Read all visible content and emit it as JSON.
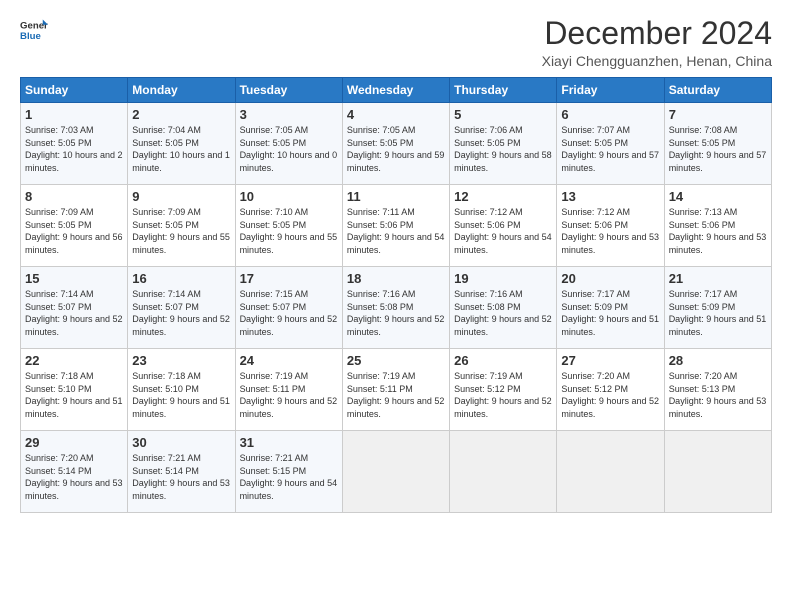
{
  "logo": {
    "line1": "General",
    "line2": "Blue"
  },
  "title": "December 2024",
  "location": "Xiayi Chengguanzhen, Henan, China",
  "days_header": [
    "Sunday",
    "Monday",
    "Tuesday",
    "Wednesday",
    "Thursday",
    "Friday",
    "Saturday"
  ],
  "weeks": [
    [
      {
        "day": "1",
        "sunrise": "Sunrise: 7:03 AM",
        "sunset": "Sunset: 5:05 PM",
        "daylight": "Daylight: 10 hours and 2 minutes."
      },
      {
        "day": "2",
        "sunrise": "Sunrise: 7:04 AM",
        "sunset": "Sunset: 5:05 PM",
        "daylight": "Daylight: 10 hours and 1 minute."
      },
      {
        "day": "3",
        "sunrise": "Sunrise: 7:05 AM",
        "sunset": "Sunset: 5:05 PM",
        "daylight": "Daylight: 10 hours and 0 minutes."
      },
      {
        "day": "4",
        "sunrise": "Sunrise: 7:05 AM",
        "sunset": "Sunset: 5:05 PM",
        "daylight": "Daylight: 9 hours and 59 minutes."
      },
      {
        "day": "5",
        "sunrise": "Sunrise: 7:06 AM",
        "sunset": "Sunset: 5:05 PM",
        "daylight": "Daylight: 9 hours and 58 minutes."
      },
      {
        "day": "6",
        "sunrise": "Sunrise: 7:07 AM",
        "sunset": "Sunset: 5:05 PM",
        "daylight": "Daylight: 9 hours and 57 minutes."
      },
      {
        "day": "7",
        "sunrise": "Sunrise: 7:08 AM",
        "sunset": "Sunset: 5:05 PM",
        "daylight": "Daylight: 9 hours and 57 minutes."
      }
    ],
    [
      {
        "day": "8",
        "sunrise": "Sunrise: 7:09 AM",
        "sunset": "Sunset: 5:05 PM",
        "daylight": "Daylight: 9 hours and 56 minutes."
      },
      {
        "day": "9",
        "sunrise": "Sunrise: 7:09 AM",
        "sunset": "Sunset: 5:05 PM",
        "daylight": "Daylight: 9 hours and 55 minutes."
      },
      {
        "day": "10",
        "sunrise": "Sunrise: 7:10 AM",
        "sunset": "Sunset: 5:05 PM",
        "daylight": "Daylight: 9 hours and 55 minutes."
      },
      {
        "day": "11",
        "sunrise": "Sunrise: 7:11 AM",
        "sunset": "Sunset: 5:06 PM",
        "daylight": "Daylight: 9 hours and 54 minutes."
      },
      {
        "day": "12",
        "sunrise": "Sunrise: 7:12 AM",
        "sunset": "Sunset: 5:06 PM",
        "daylight": "Daylight: 9 hours and 54 minutes."
      },
      {
        "day": "13",
        "sunrise": "Sunrise: 7:12 AM",
        "sunset": "Sunset: 5:06 PM",
        "daylight": "Daylight: 9 hours and 53 minutes."
      },
      {
        "day": "14",
        "sunrise": "Sunrise: 7:13 AM",
        "sunset": "Sunset: 5:06 PM",
        "daylight": "Daylight: 9 hours and 53 minutes."
      }
    ],
    [
      {
        "day": "15",
        "sunrise": "Sunrise: 7:14 AM",
        "sunset": "Sunset: 5:07 PM",
        "daylight": "Daylight: 9 hours and 52 minutes."
      },
      {
        "day": "16",
        "sunrise": "Sunrise: 7:14 AM",
        "sunset": "Sunset: 5:07 PM",
        "daylight": "Daylight: 9 hours and 52 minutes."
      },
      {
        "day": "17",
        "sunrise": "Sunrise: 7:15 AM",
        "sunset": "Sunset: 5:07 PM",
        "daylight": "Daylight: 9 hours and 52 minutes."
      },
      {
        "day": "18",
        "sunrise": "Sunrise: 7:16 AM",
        "sunset": "Sunset: 5:08 PM",
        "daylight": "Daylight: 9 hours and 52 minutes."
      },
      {
        "day": "19",
        "sunrise": "Sunrise: 7:16 AM",
        "sunset": "Sunset: 5:08 PM",
        "daylight": "Daylight: 9 hours and 52 minutes."
      },
      {
        "day": "20",
        "sunrise": "Sunrise: 7:17 AM",
        "sunset": "Sunset: 5:09 PM",
        "daylight": "Daylight: 9 hours and 51 minutes."
      },
      {
        "day": "21",
        "sunrise": "Sunrise: 7:17 AM",
        "sunset": "Sunset: 5:09 PM",
        "daylight": "Daylight: 9 hours and 51 minutes."
      }
    ],
    [
      {
        "day": "22",
        "sunrise": "Sunrise: 7:18 AM",
        "sunset": "Sunset: 5:10 PM",
        "daylight": "Daylight: 9 hours and 51 minutes."
      },
      {
        "day": "23",
        "sunrise": "Sunrise: 7:18 AM",
        "sunset": "Sunset: 5:10 PM",
        "daylight": "Daylight: 9 hours and 51 minutes."
      },
      {
        "day": "24",
        "sunrise": "Sunrise: 7:19 AM",
        "sunset": "Sunset: 5:11 PM",
        "daylight": "Daylight: 9 hours and 52 minutes."
      },
      {
        "day": "25",
        "sunrise": "Sunrise: 7:19 AM",
        "sunset": "Sunset: 5:11 PM",
        "daylight": "Daylight: 9 hours and 52 minutes."
      },
      {
        "day": "26",
        "sunrise": "Sunrise: 7:19 AM",
        "sunset": "Sunset: 5:12 PM",
        "daylight": "Daylight: 9 hours and 52 minutes."
      },
      {
        "day": "27",
        "sunrise": "Sunrise: 7:20 AM",
        "sunset": "Sunset: 5:12 PM",
        "daylight": "Daylight: 9 hours and 52 minutes."
      },
      {
        "day": "28",
        "sunrise": "Sunrise: 7:20 AM",
        "sunset": "Sunset: 5:13 PM",
        "daylight": "Daylight: 9 hours and 53 minutes."
      }
    ],
    [
      {
        "day": "29",
        "sunrise": "Sunrise: 7:20 AM",
        "sunset": "Sunset: 5:14 PM",
        "daylight": "Daylight: 9 hours and 53 minutes."
      },
      {
        "day": "30",
        "sunrise": "Sunrise: 7:21 AM",
        "sunset": "Sunset: 5:14 PM",
        "daylight": "Daylight: 9 hours and 53 minutes."
      },
      {
        "day": "31",
        "sunrise": "Sunrise: 7:21 AM",
        "sunset": "Sunset: 5:15 PM",
        "daylight": "Daylight: 9 hours and 54 minutes."
      },
      null,
      null,
      null,
      null
    ]
  ]
}
